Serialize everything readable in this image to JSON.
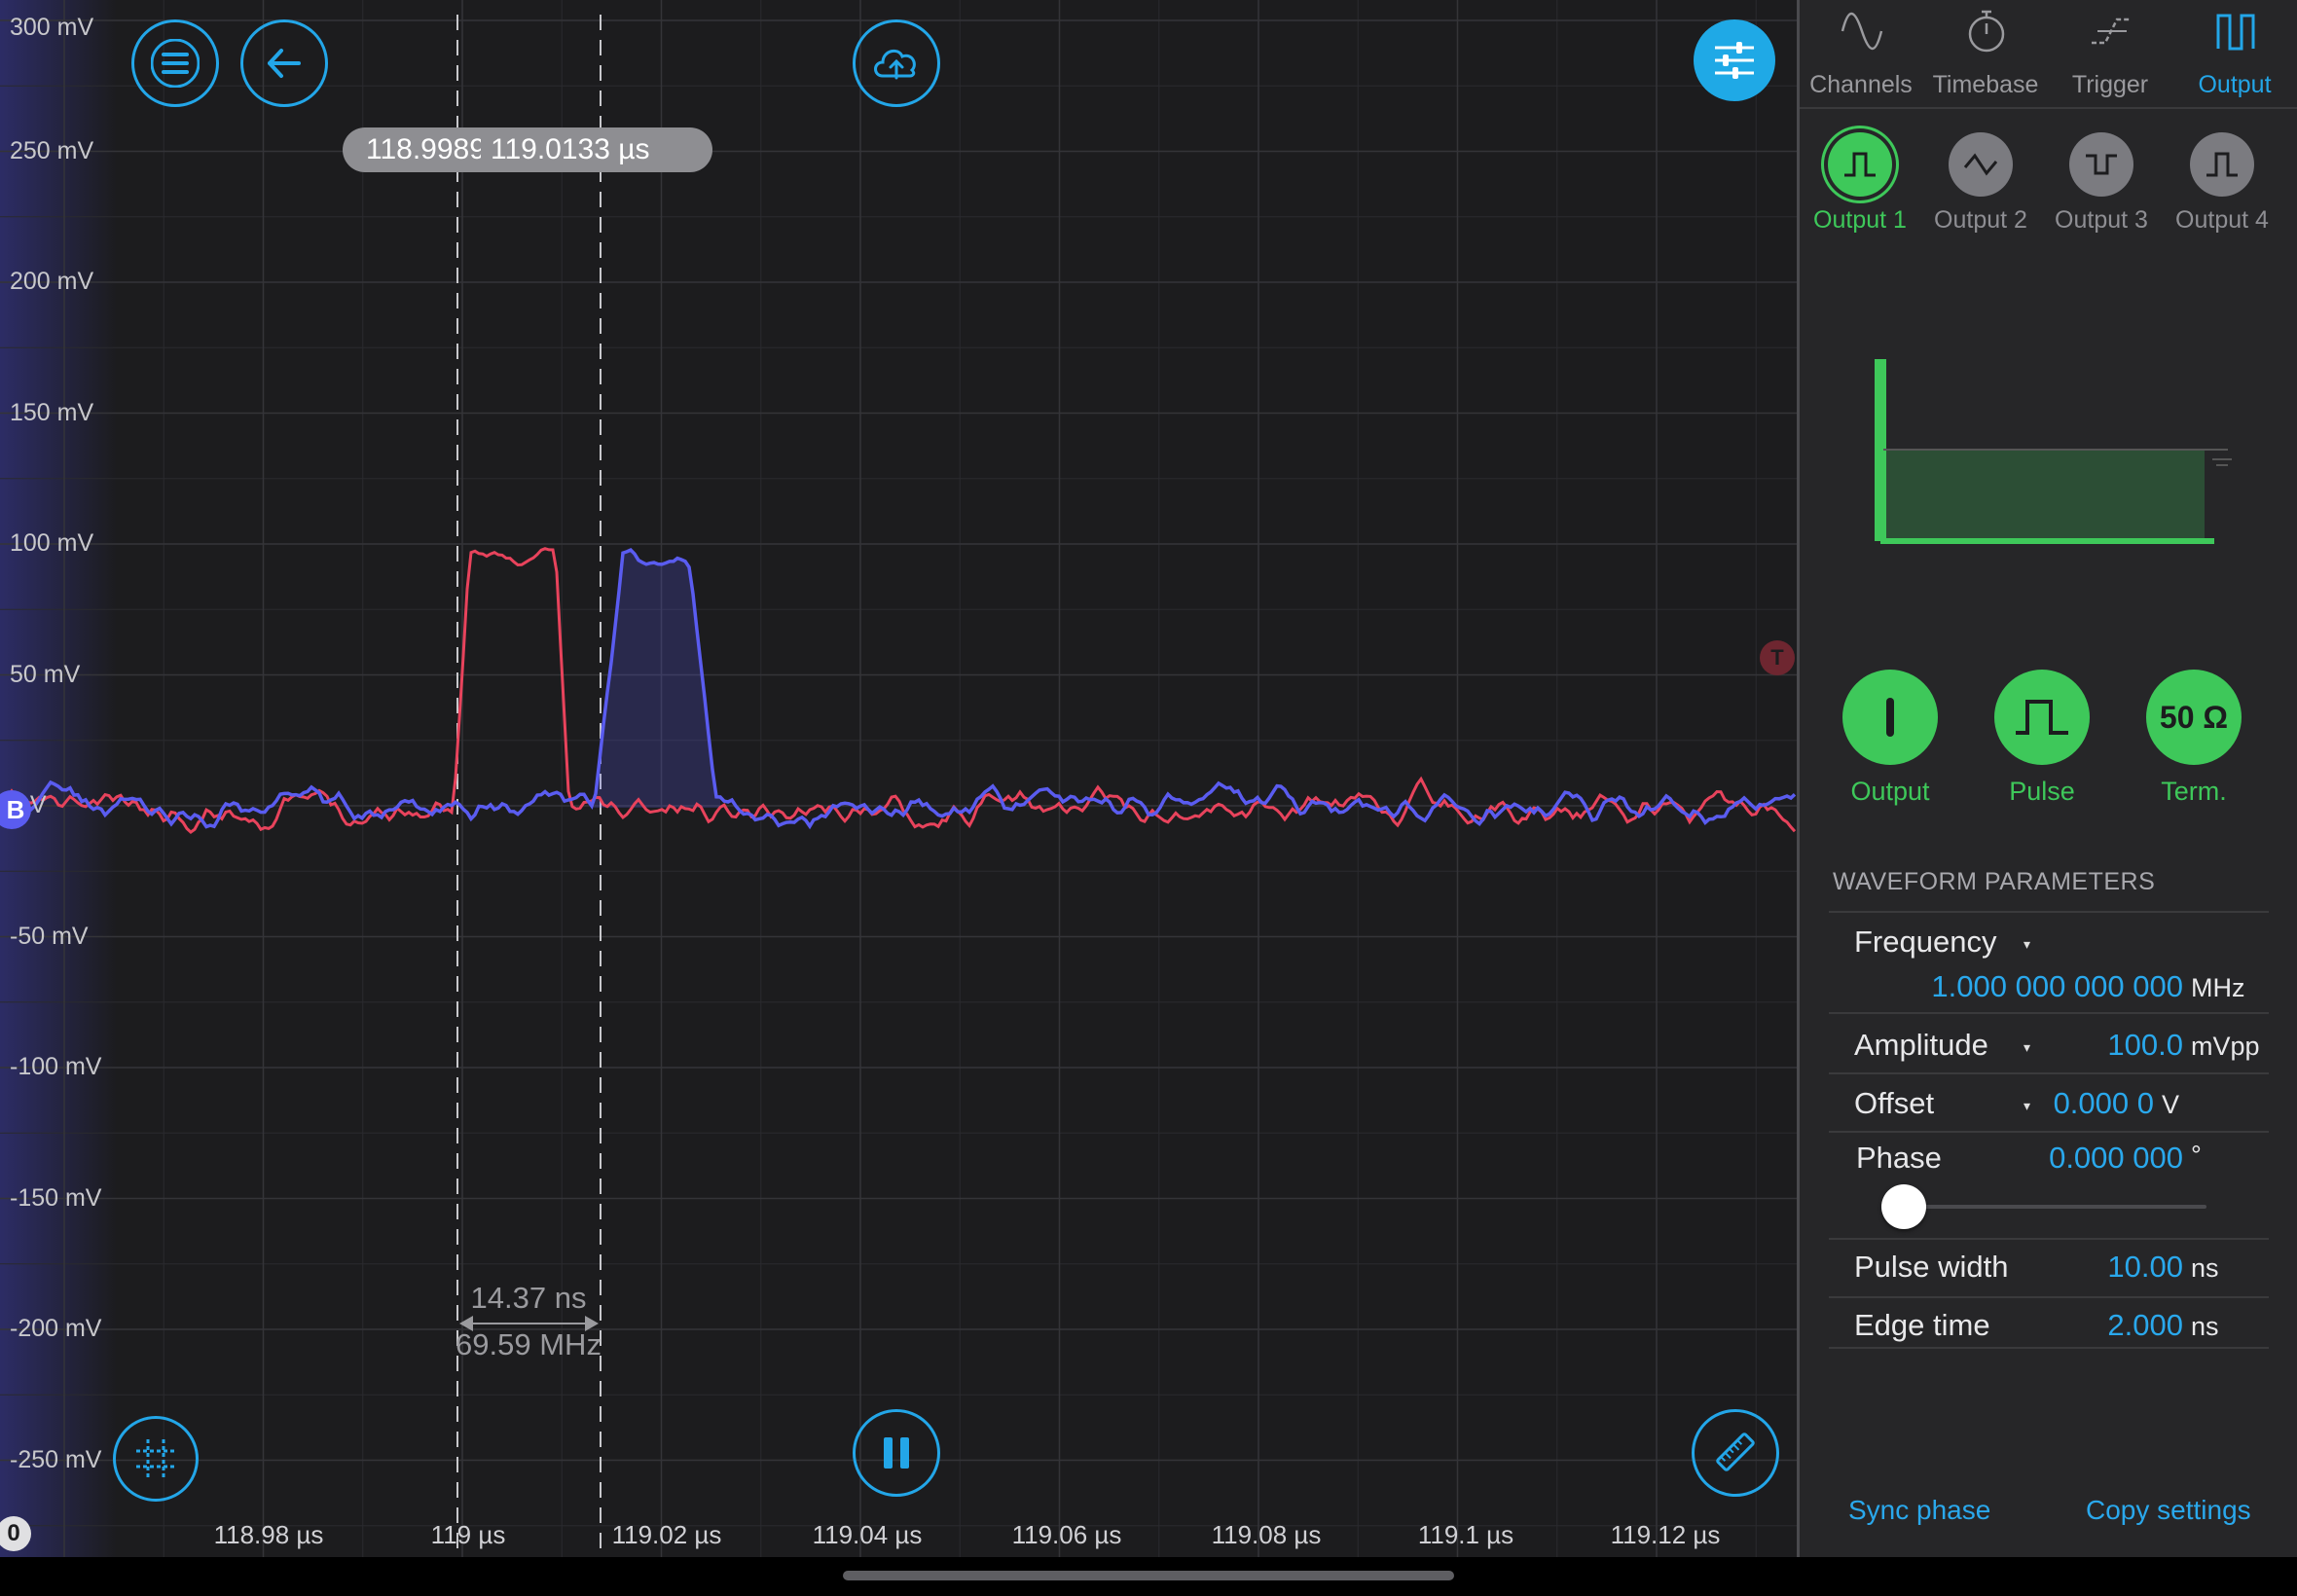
{
  "scope": {
    "y_axis_labels": [
      "300 mV",
      "250 mV",
      "200 mV",
      "150 mV",
      "100 mV",
      "50 mV",
      "0 V",
      "-50 mV",
      "-100 mV",
      "-150 mV",
      "-200 mV",
      "-250 mV"
    ],
    "x_axis_labels": [
      "118.98 µs",
      "119 µs",
      "119.02 µs",
      "119.04 µs",
      "119.06 µs",
      "119.08 µs",
      "119.1 µs",
      "119.12 µs"
    ],
    "cursor_readout": {
      "left": "118.9989",
      "right": "119.0133 µs"
    },
    "measurement": {
      "delta_time": "14.37 ns",
      "frequency": "69.59 MHz"
    },
    "channel_marker": "B",
    "trigger_marker": "T",
    "ground_marker": "0",
    "colors": {
      "channel_red": "#e8435c",
      "channel_blue": "#5a5cf0",
      "accent": "#23a6e8",
      "green": "#3ec85a"
    },
    "buttons": {
      "menu_icon": "menu-icon",
      "back_icon": "back-arrow-icon",
      "upload_icon": "cloud-upload-icon",
      "settings_icon": "sliders-icon",
      "grid_icon": "grid-icon",
      "pause_icon": "pause-icon",
      "ruler_icon": "ruler-icon"
    }
  },
  "panel": {
    "tabs": [
      {
        "label": "Channels",
        "icon": "sine-icon"
      },
      {
        "label": "Timebase",
        "icon": "stopwatch-icon"
      },
      {
        "label": "Trigger",
        "icon": "trigger-edge-icon"
      },
      {
        "label": "Output",
        "icon": "pulse-output-icon",
        "active": true
      }
    ],
    "outputs": [
      "Output 1",
      "Output 2",
      "Output 3",
      "Output 4"
    ],
    "toggles": {
      "output": "Output",
      "pulse": "Pulse",
      "term": "Term.",
      "term_value": "50 Ω"
    },
    "section_title": "WAVEFORM PARAMETERS",
    "params": {
      "frequency": {
        "name": "Frequency",
        "value": "1.000 000 000 000",
        "unit": "MHz"
      },
      "amplitude": {
        "name": "Amplitude",
        "value": "100.0",
        "unit": "mVpp"
      },
      "offset": {
        "name": "Offset",
        "value": "0.000 0",
        "unit": "V"
      },
      "phase": {
        "name": "Phase",
        "value": "0.000 000",
        "unit": "°",
        "slider_fraction": 0.0
      },
      "pulse_width": {
        "name": "Pulse width",
        "value": "10.00",
        "unit": "ns"
      },
      "edge_time": {
        "name": "Edge time",
        "value": "2.000",
        "unit": "ns"
      }
    },
    "actions": {
      "sync_phase": "Sync phase",
      "copy_settings": "Copy settings"
    }
  }
}
